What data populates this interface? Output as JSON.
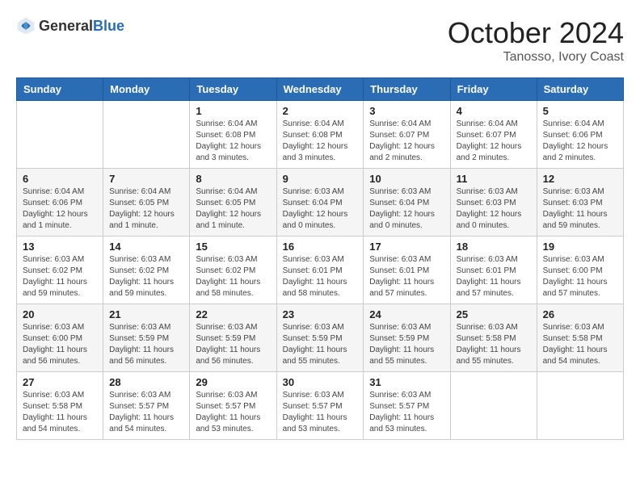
{
  "logo": {
    "text_general": "General",
    "text_blue": "Blue"
  },
  "title": {
    "month": "October 2024",
    "location": "Tanosso, Ivory Coast"
  },
  "headers": [
    "Sunday",
    "Monday",
    "Tuesday",
    "Wednesday",
    "Thursday",
    "Friday",
    "Saturday"
  ],
  "weeks": [
    [
      {
        "day": "",
        "info": ""
      },
      {
        "day": "",
        "info": ""
      },
      {
        "day": "1",
        "info": "Sunrise: 6:04 AM\nSunset: 6:08 PM\nDaylight: 12 hours\nand 3 minutes."
      },
      {
        "day": "2",
        "info": "Sunrise: 6:04 AM\nSunset: 6:08 PM\nDaylight: 12 hours\nand 3 minutes."
      },
      {
        "day": "3",
        "info": "Sunrise: 6:04 AM\nSunset: 6:07 PM\nDaylight: 12 hours\nand 2 minutes."
      },
      {
        "day": "4",
        "info": "Sunrise: 6:04 AM\nSunset: 6:07 PM\nDaylight: 12 hours\nand 2 minutes."
      },
      {
        "day": "5",
        "info": "Sunrise: 6:04 AM\nSunset: 6:06 PM\nDaylight: 12 hours\nand 2 minutes."
      }
    ],
    [
      {
        "day": "6",
        "info": "Sunrise: 6:04 AM\nSunset: 6:06 PM\nDaylight: 12 hours\nand 1 minute."
      },
      {
        "day": "7",
        "info": "Sunrise: 6:04 AM\nSunset: 6:05 PM\nDaylight: 12 hours\nand 1 minute."
      },
      {
        "day": "8",
        "info": "Sunrise: 6:04 AM\nSunset: 6:05 PM\nDaylight: 12 hours\nand 1 minute."
      },
      {
        "day": "9",
        "info": "Sunrise: 6:03 AM\nSunset: 6:04 PM\nDaylight: 12 hours\nand 0 minutes."
      },
      {
        "day": "10",
        "info": "Sunrise: 6:03 AM\nSunset: 6:04 PM\nDaylight: 12 hours\nand 0 minutes."
      },
      {
        "day": "11",
        "info": "Sunrise: 6:03 AM\nSunset: 6:03 PM\nDaylight: 12 hours\nand 0 minutes."
      },
      {
        "day": "12",
        "info": "Sunrise: 6:03 AM\nSunset: 6:03 PM\nDaylight: 11 hours\nand 59 minutes."
      }
    ],
    [
      {
        "day": "13",
        "info": "Sunrise: 6:03 AM\nSunset: 6:02 PM\nDaylight: 11 hours\nand 59 minutes."
      },
      {
        "day": "14",
        "info": "Sunrise: 6:03 AM\nSunset: 6:02 PM\nDaylight: 11 hours\nand 59 minutes."
      },
      {
        "day": "15",
        "info": "Sunrise: 6:03 AM\nSunset: 6:02 PM\nDaylight: 11 hours\nand 58 minutes."
      },
      {
        "day": "16",
        "info": "Sunrise: 6:03 AM\nSunset: 6:01 PM\nDaylight: 11 hours\nand 58 minutes."
      },
      {
        "day": "17",
        "info": "Sunrise: 6:03 AM\nSunset: 6:01 PM\nDaylight: 11 hours\nand 57 minutes."
      },
      {
        "day": "18",
        "info": "Sunrise: 6:03 AM\nSunset: 6:01 PM\nDaylight: 11 hours\nand 57 minutes."
      },
      {
        "day": "19",
        "info": "Sunrise: 6:03 AM\nSunset: 6:00 PM\nDaylight: 11 hours\nand 57 minutes."
      }
    ],
    [
      {
        "day": "20",
        "info": "Sunrise: 6:03 AM\nSunset: 6:00 PM\nDaylight: 11 hours\nand 56 minutes."
      },
      {
        "day": "21",
        "info": "Sunrise: 6:03 AM\nSunset: 5:59 PM\nDaylight: 11 hours\nand 56 minutes."
      },
      {
        "day": "22",
        "info": "Sunrise: 6:03 AM\nSunset: 5:59 PM\nDaylight: 11 hours\nand 56 minutes."
      },
      {
        "day": "23",
        "info": "Sunrise: 6:03 AM\nSunset: 5:59 PM\nDaylight: 11 hours\nand 55 minutes."
      },
      {
        "day": "24",
        "info": "Sunrise: 6:03 AM\nSunset: 5:59 PM\nDaylight: 11 hours\nand 55 minutes."
      },
      {
        "day": "25",
        "info": "Sunrise: 6:03 AM\nSunset: 5:58 PM\nDaylight: 11 hours\nand 55 minutes."
      },
      {
        "day": "26",
        "info": "Sunrise: 6:03 AM\nSunset: 5:58 PM\nDaylight: 11 hours\nand 54 minutes."
      }
    ],
    [
      {
        "day": "27",
        "info": "Sunrise: 6:03 AM\nSunset: 5:58 PM\nDaylight: 11 hours\nand 54 minutes."
      },
      {
        "day": "28",
        "info": "Sunrise: 6:03 AM\nSunset: 5:57 PM\nDaylight: 11 hours\nand 54 minutes."
      },
      {
        "day": "29",
        "info": "Sunrise: 6:03 AM\nSunset: 5:57 PM\nDaylight: 11 hours\nand 53 minutes."
      },
      {
        "day": "30",
        "info": "Sunrise: 6:03 AM\nSunset: 5:57 PM\nDaylight: 11 hours\nand 53 minutes."
      },
      {
        "day": "31",
        "info": "Sunrise: 6:03 AM\nSunset: 5:57 PM\nDaylight: 11 hours\nand 53 minutes."
      },
      {
        "day": "",
        "info": ""
      },
      {
        "day": "",
        "info": ""
      }
    ]
  ]
}
